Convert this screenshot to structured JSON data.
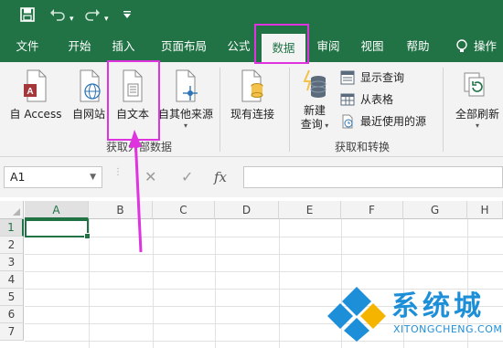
{
  "qat": {
    "save_icon": "save-icon",
    "undo_icon": "undo-icon",
    "redo_icon": "redo-icon",
    "customize_icon": "customize-qat-icon"
  },
  "tabs": [
    {
      "label": "文件"
    },
    {
      "label": "开始"
    },
    {
      "label": "插入"
    },
    {
      "label": "页面布局"
    },
    {
      "label": "公式"
    },
    {
      "label": "数据"
    },
    {
      "label": "审阅"
    },
    {
      "label": "视图"
    },
    {
      "label": "帮助"
    },
    {
      "label": "操作"
    }
  ],
  "ribbon": {
    "get_external": {
      "from_access": "自 Access",
      "from_web": "自网站",
      "from_text": "自文本",
      "from_other": "自其他来源",
      "existing": "现有连接",
      "group_label": "获取外部数据"
    },
    "get_transform": {
      "new_query_line1": "新建",
      "new_query_line2": "查询",
      "show_queries": "显示查询",
      "from_table": "从表格",
      "recent_sources": "最近使用的源",
      "group_label": "获取和转换"
    },
    "connections": {
      "refresh_all": "全部刷新"
    }
  },
  "formula_bar": {
    "name_box": "A1",
    "cancel_symbol": "✕",
    "enter_symbol": "✓",
    "fx_symbol": "fx",
    "formula": ""
  },
  "grid": {
    "columns": [
      "A",
      "B",
      "C",
      "D",
      "E",
      "F",
      "G",
      "H"
    ],
    "rows": [
      "1",
      "2",
      "3",
      "4",
      "5",
      "6",
      "7"
    ]
  },
  "colors": {
    "brand_green": "#217346",
    "highlight": "#e033e0",
    "watermark_blue": "#1d8fd8"
  },
  "watermark": {
    "title": "系统城",
    "subtitle": "XITONGCHENG.COM"
  }
}
